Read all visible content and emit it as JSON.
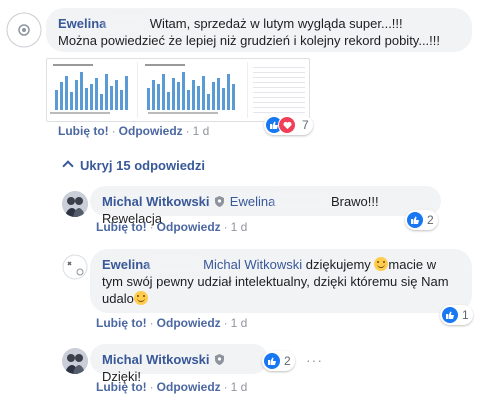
{
  "comments": [
    {
      "author": "Ewelina",
      "text_line1": "Witam, sprzedaż w lutym wygląda super...!!!",
      "text_line2": "Można powiedzieć że lepiej niż grudzień i kolejny rekord pobity...!!!",
      "like_label": "Lubię to!",
      "reply_label": "Odpowiedz",
      "time": "1 d",
      "reaction_count": "7"
    }
  ],
  "toggle_replies": "Ukryj 15 odpowiedzi",
  "replies": [
    {
      "author": "Michal Witkowski",
      "mention": "Ewelina",
      "text": "Brawo!!! Rewelacja",
      "like_label": "Lubię to!",
      "reply_label": "Odpowiedz",
      "time": "1 d",
      "reaction_count": "2"
    },
    {
      "author": "Ewelina",
      "mention": "Michal Witkowski",
      "text_a": "dziękujemy",
      "text_b": "macie w",
      "text_line2": "tym swój pewny udział intelektualny, dzięki któremu się Nam",
      "text_line3": "udalo",
      "like_label": "Lubię to!",
      "reply_label": "Odpowiedz",
      "time": "1 d",
      "reaction_count": "1"
    },
    {
      "author": "Michal Witkowski",
      "text": "Dzięki!",
      "like_label": "Lubię to!",
      "reply_label": "Odpowiedz",
      "time": "1 d",
      "reaction_count": "2",
      "more": "···"
    }
  ],
  "colors": {
    "link": "#385898",
    "like": "#1877f2",
    "heart": "#f33e58",
    "bubble": "#f2f3f5"
  }
}
